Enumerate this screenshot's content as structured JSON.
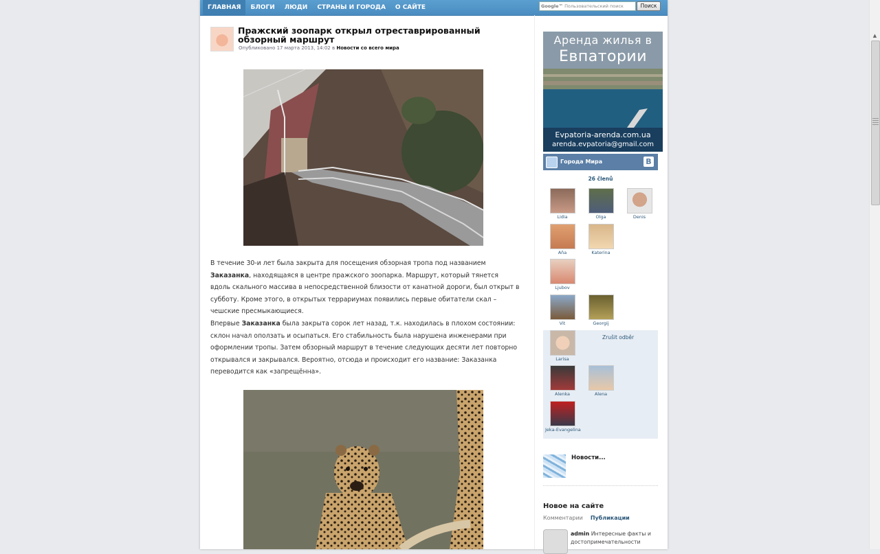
{
  "nav": {
    "items": [
      "Главная",
      "Блоги",
      "Люди",
      "Страны и города",
      "О сайте"
    ],
    "search_brand": "Google™",
    "search_placeholder": "Пользовательский поиск",
    "search_button": "Поиск"
  },
  "post": {
    "title": "Пражский зоопарк открыл отреставрированный обзорный маршрут",
    "meta_prefix": "Опубликовано 17 марта 2013, 14:02 в",
    "meta_category": "Новости со всего мира",
    "paragraph_1_a": "В течение 30-и лет была закрыта для посещения обзорная тропа под названием ",
    "paragraph_1_bold": "Заказанка",
    "paragraph_1_b": ", находящаяся в центре пражского зоопарка. Маршрут, который тянется вдоль скального массива в непосредственной близости от канатной дороги, был открыт в субботу. Кроме этого, в открытых террариумах появились первые обитатели скал – чешские пресмыкающиеся.",
    "paragraph_2_a": "Впервые ",
    "paragraph_2_bold": "Заказанка",
    "paragraph_2_b": " была закрыта сорок лет назад, т.к. находилась в плохом состоянии: склон начал оползать и осыпаться. Его стабильность была нарушена инженерами при оформлении тропы. Затем обзорный маршрут в течение следующих десяти лет повторно открывался и закрывался. Вероятно, отсюда и происходит его название: Заказанка переводится как «запрещённа»."
  },
  "sidebar": {
    "ad": {
      "line1": "Аренда жилья в",
      "line2": "Евпатории",
      "site": "Evpatoria-arenda.com.ua",
      "email": "arenda.evpatoria@gmail.com"
    },
    "vk": {
      "group_name": "Города Мира",
      "logo": "B",
      "members_count": "26 členů",
      "unsubscribe": "Zrušit odběr",
      "members": [
        "Lidia",
        "Olga",
        "Denis",
        "Aňa",
        "Katerina",
        "Ljubov",
        "Vit",
        "Georgij",
        "Larisa",
        "Alenka",
        "Alena",
        "Jeka-Evangelina"
      ]
    },
    "news_title": "Новости...",
    "new_on_site": {
      "title": "Новое на сайте",
      "tabs": [
        "Комментарии",
        "Публикации"
      ],
      "entry_author": "admin",
      "entry_text": "Интересные факты и достопримечательности"
    }
  }
}
